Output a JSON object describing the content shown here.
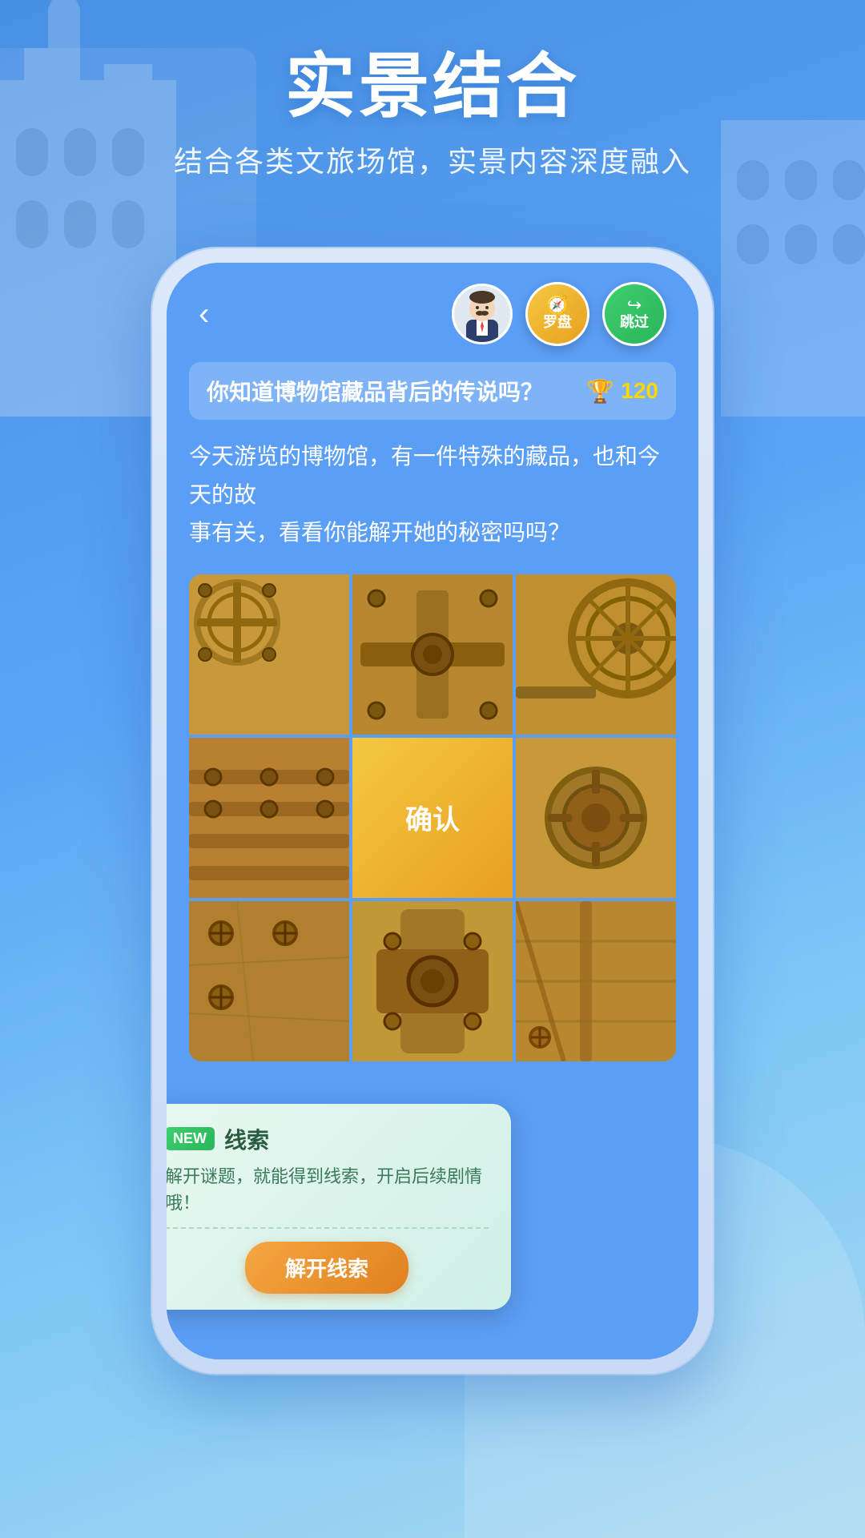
{
  "background": {
    "gradient_start": "#4a90e2",
    "gradient_end": "#a8d8f0"
  },
  "header": {
    "title": "实景结合",
    "subtitle": "结合各类文旅场馆，实景内容深度融入"
  },
  "phone": {
    "back_button": "‹",
    "topbar": {
      "compass_label": "罗盘",
      "skip_label": "跳过"
    },
    "question_bar": {
      "text": "你知道博物馆藏品背后的传说吗？",
      "score": "120"
    },
    "description": "今天游览的博物馆，有一件特殊的藏品，也和今天的故\n事有关，看看你能解开她的秘密吗吗？",
    "puzzle": {
      "confirm_label": "确认"
    },
    "clue_card": {
      "new_badge": "NEW",
      "title": "线索",
      "description": "解开谜题，就能得到线索，开启后续剧情哦！",
      "unlock_button": "解开线索"
    }
  }
}
